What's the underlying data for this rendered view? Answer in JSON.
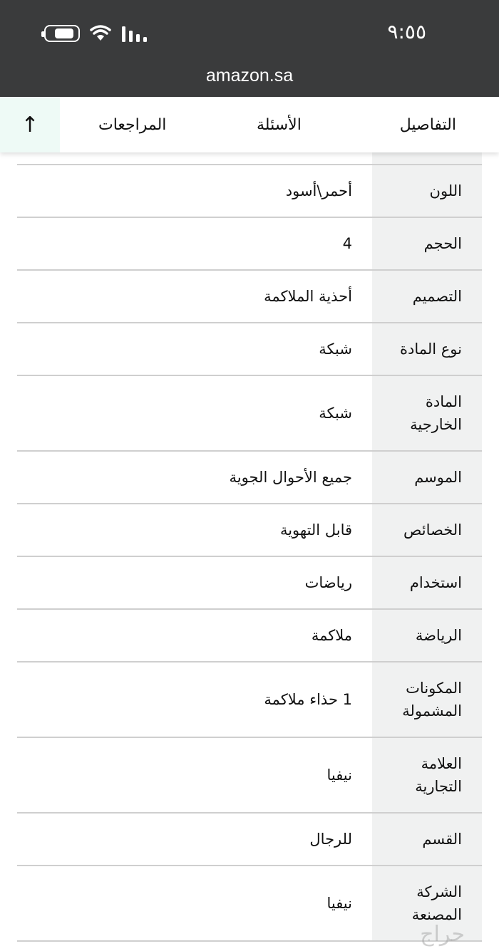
{
  "status_bar": {
    "time": "٩:٥٥",
    "battery_icon": "battery-icon",
    "wifi_icon": "wifi-icon",
    "signal_icon": "signal-icon"
  },
  "browser": {
    "url": "amazon.sa"
  },
  "tabs": {
    "up_icon": "↑",
    "reviews": "المراجعات",
    "questions": "الأسئلة",
    "details": "التفاصيل"
  },
  "details": [
    {
      "key": "اللون",
      "value": "أحمر\\أسود"
    },
    {
      "key": "الحجم",
      "value": "4"
    },
    {
      "key": "التصميم",
      "value": "أحذية الملاكمة"
    },
    {
      "key": "نوع المادة",
      "value": "شبكة"
    },
    {
      "key": "المادة الخارجية",
      "value": "شبكة"
    },
    {
      "key": "الموسم",
      "value": "جميع الأحوال الجوية"
    },
    {
      "key": "الخصائص",
      "value": "قابل التهوية"
    },
    {
      "key": "استخدام",
      "value": "رياضات"
    },
    {
      "key": "الرياضة",
      "value": "ملاكمة"
    },
    {
      "key": "المكونات المشمولة",
      "value": "1 حذاء ملاكمة"
    },
    {
      "key": "العلامة التجارية",
      "value": "نيفيا"
    },
    {
      "key": "القسم",
      "value": "للرجال"
    },
    {
      "key": "الشركة المصنعة",
      "value": "نيفيا"
    }
  ],
  "watermark": "حراج"
}
